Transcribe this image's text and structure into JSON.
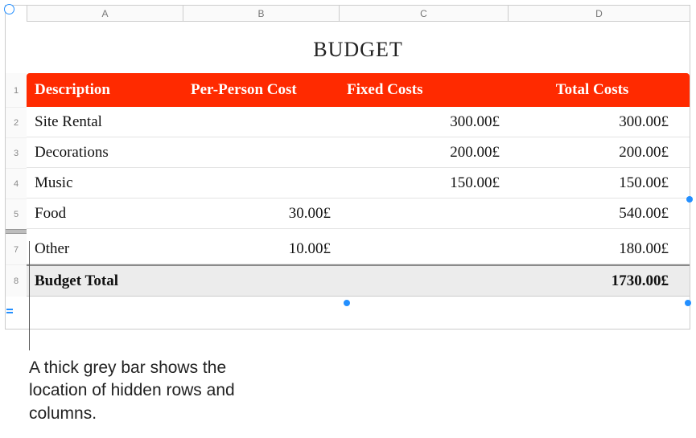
{
  "title": "BUDGET",
  "columns": {
    "A": {
      "letter": "A",
      "header": "Description"
    },
    "B": {
      "letter": "B",
      "header": "Per-Person Cost"
    },
    "C": {
      "letter": "C",
      "header": "Fixed Costs"
    },
    "D": {
      "letter": "D",
      "header": "Total Costs"
    }
  },
  "row_numbers": [
    "1",
    "2",
    "3",
    "4",
    "5",
    "7",
    "8"
  ],
  "rows": [
    {
      "desc": "Site Rental",
      "per": "",
      "fixed": "300.00£",
      "total": "300.00£"
    },
    {
      "desc": "Decorations",
      "per": "",
      "fixed": "200.00£",
      "total": "200.00£"
    },
    {
      "desc": "Music",
      "per": "",
      "fixed": "150.00£",
      "total": "150.00£"
    },
    {
      "desc": "Food",
      "per": "30.00£",
      "fixed": "",
      "total": "540.00£"
    },
    {
      "desc": "Other",
      "per": "10.00£",
      "fixed": "",
      "total": "180.00£"
    }
  ],
  "total_row": {
    "label": "Budget Total",
    "value": "1730.00£"
  },
  "callout": "A thick grey bar shows the location of hidden rows and columns."
}
